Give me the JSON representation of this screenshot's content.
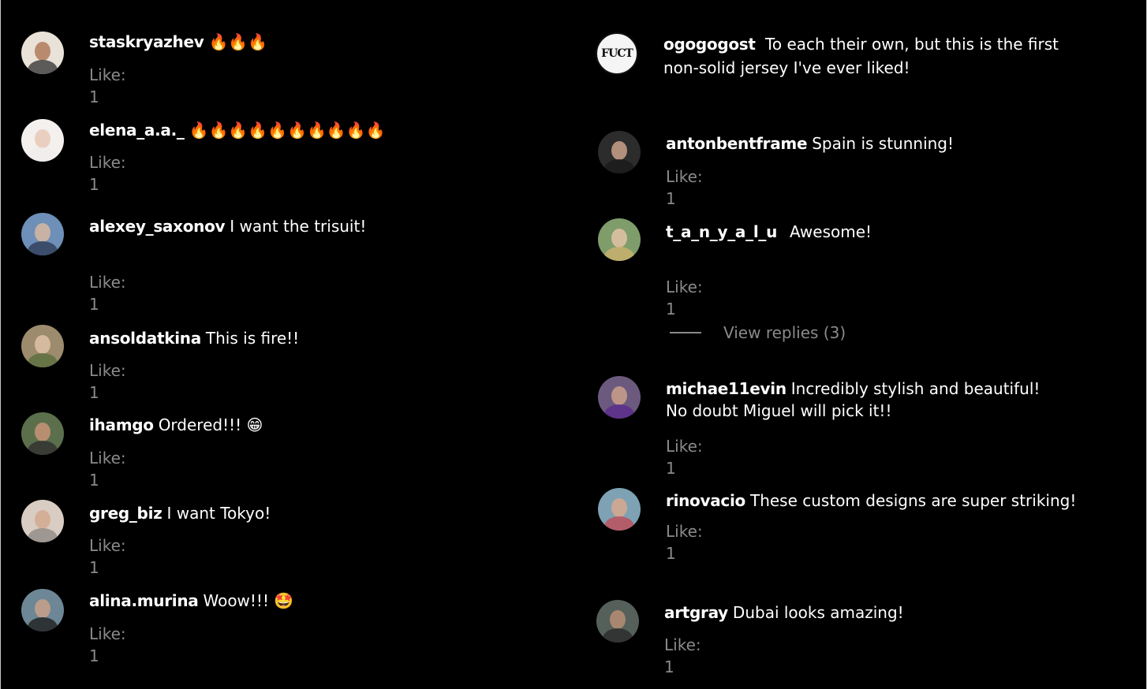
{
  "colors": {
    "background": "#000000",
    "text": "#ffffff",
    "muted": "#8a8a8a"
  },
  "left_column": [
    {
      "username": "staskryazhev",
      "text": "",
      "emoji": "🔥🔥🔥",
      "like": "Like: 1",
      "avatar": {
        "bg": "#e9e2d8",
        "skin": "#b07a5c",
        "shirt": "#3a3a3a"
      }
    },
    {
      "username": "elena_a.a._",
      "text": "",
      "emoji": "🔥🔥🔥🔥🔥🔥🔥🔥🔥🔥",
      "like": "Like: 1",
      "avatar": {
        "bg": "#f4f0ee",
        "skin": "#e7c9b7",
        "shirt": "#f0eceb"
      }
    },
    {
      "username": "alexey_saxonov",
      "text": "I want the trisuit!",
      "emoji": "",
      "like": "Like: 1",
      "avatar": {
        "bg": "#6e8fb7",
        "skin": "#d7b8a1",
        "shirt": "#2f3c58"
      }
    },
    {
      "username": "ansoldatkina",
      "text": "This is fire!!",
      "emoji": "",
      "like": "Like: 1",
      "avatar": {
        "bg": "#9d8b6e",
        "skin": "#e0c2a6",
        "shirt": "#5a6e3c"
      }
    },
    {
      "username": "ihamgo",
      "text": "Ordered!!!",
      "emoji": "😁",
      "like": "Like: 1",
      "avatar": {
        "bg": "#5b6f4c",
        "skin": "#c99477",
        "shirt": "#2f2f2f"
      }
    },
    {
      "username": "greg_biz",
      "text": "I want Tokyo!",
      "emoji": "",
      "like": "Like: 1",
      "avatar": {
        "bg": "#d9cdc3",
        "skin": "#d2a990",
        "shirt": "#8f8a86"
      }
    },
    {
      "username": "alina.murina",
      "text": "Woow!!!",
      "emoji": "🤩",
      "like": "Like: 1",
      "avatar": {
        "bg": "#6d8797",
        "skin": "#c8a188",
        "shirt": "#1e1e1e"
      }
    }
  ],
  "right_column": [
    {
      "username": "ogogogost",
      "text": "To each their own, but this is the first non-solid jersey I've ever liked!",
      "emoji": "",
      "like": "",
      "avatar": {
        "bg": "#f5f5f5",
        "skin": "#f5f5f5",
        "shirt": "#f5f5f5",
        "logo": "FUCT"
      }
    },
    {
      "username": "antonbentframe",
      "text": "Spain is stunning!",
      "emoji": "",
      "like": "Like: 1",
      "avatar": {
        "bg": "#2c2c2c",
        "skin": "#caa28b",
        "shirt": "#1a1a1a"
      }
    },
    {
      "username": "t_a_n_y_a_l_u",
      "text": "Awesome!",
      "emoji": "",
      "like": "Like: 1",
      "avatar": {
        "bg": "#7f9c6b",
        "skin": "#e3c3a6",
        "shirt": "#cdb36f"
      }
    },
    {
      "username": "michae11evin",
      "text": "Incredibly stylish and beautiful! No doubt Miguel will pick it!!",
      "emoji": "",
      "like": "Like: 1",
      "avatar": {
        "bg": "#6b5a7e",
        "skin": "#caa08a",
        "shirt": "#5a2a8c"
      }
    },
    {
      "username": "rinovacio",
      "text": "These custom designs are super striking!",
      "emoji": "",
      "like": "Like: 1",
      "avatar": {
        "bg": "#7ea1b3",
        "skin": "#d7a98e",
        "shirt": "#c04c58"
      }
    },
    {
      "username": "artgray",
      "text": "Dubai looks amazing!",
      "emoji": "",
      "like": "Like: 1",
      "avatar": {
        "bg": "#55605a",
        "skin": "#b98d74",
        "shirt": "#2b2b2b"
      }
    }
  ],
  "view_replies": "View replies (3)"
}
